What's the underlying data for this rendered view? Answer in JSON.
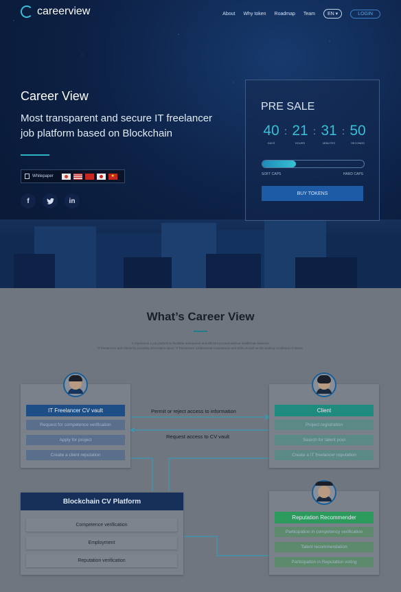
{
  "nav": {
    "logo": "careerview",
    "items": [
      "About",
      "Why token",
      "Roadmap",
      "Team"
    ],
    "lang": "EN ▾",
    "login": "LOGIN"
  },
  "hero": {
    "title": "Career View",
    "subtitle": "Most transparent and secure IT freelancer job platform based on Blockchain",
    "whitepaper": "Whitepaper"
  },
  "presale": {
    "title": "PRE SALE",
    "days": "40",
    "hours": "21",
    "minutes": "31",
    "seconds": "50",
    "days_label": "DAYS",
    "hours_label": "HOURS",
    "minutes_label": "MINUTES",
    "seconds_label": "SECONDS",
    "progress": 0.33,
    "soft_caps": "SOFT CAPS",
    "hard_caps": "HARD CAPS",
    "buy": "BUY TOKENS"
  },
  "colors": {
    "accent": "#2cb5c5",
    "navy": "#16305a",
    "client_green": "#1f8a7e",
    "reputation_green": "#2c9a5c"
  },
  "whats": {
    "title": "What’s Career View",
    "desc1": "It represents a job platform to facilitate transparent and efficient process without middleman between",
    "desc2": "IT freelancers and clients by providing information about 'IT freelancers' professional competence and skills as well as the working conditions of clients."
  },
  "freelancer": {
    "header": "IT Freelancer CV vault",
    "rows": [
      "Request for competence verification",
      "Apply for project",
      "Create a client reputation"
    ]
  },
  "flow": {
    "permit": "Permit or reject access to information",
    "request": "Request access to CV vault"
  },
  "client": {
    "header": "Client",
    "rows": [
      "Project registration",
      "Search for talent pool",
      "Create a IT freelancer reputation"
    ]
  },
  "platform": {
    "header": "Blockchain CV Platform",
    "rows": [
      "Competence verification",
      "Employment",
      "Reputation verification"
    ]
  },
  "reputation": {
    "header": "Reputation Recommender",
    "rows": [
      "Participation in competency verification",
      "Talent recommendation",
      "Participation in Reputation voting"
    ]
  }
}
